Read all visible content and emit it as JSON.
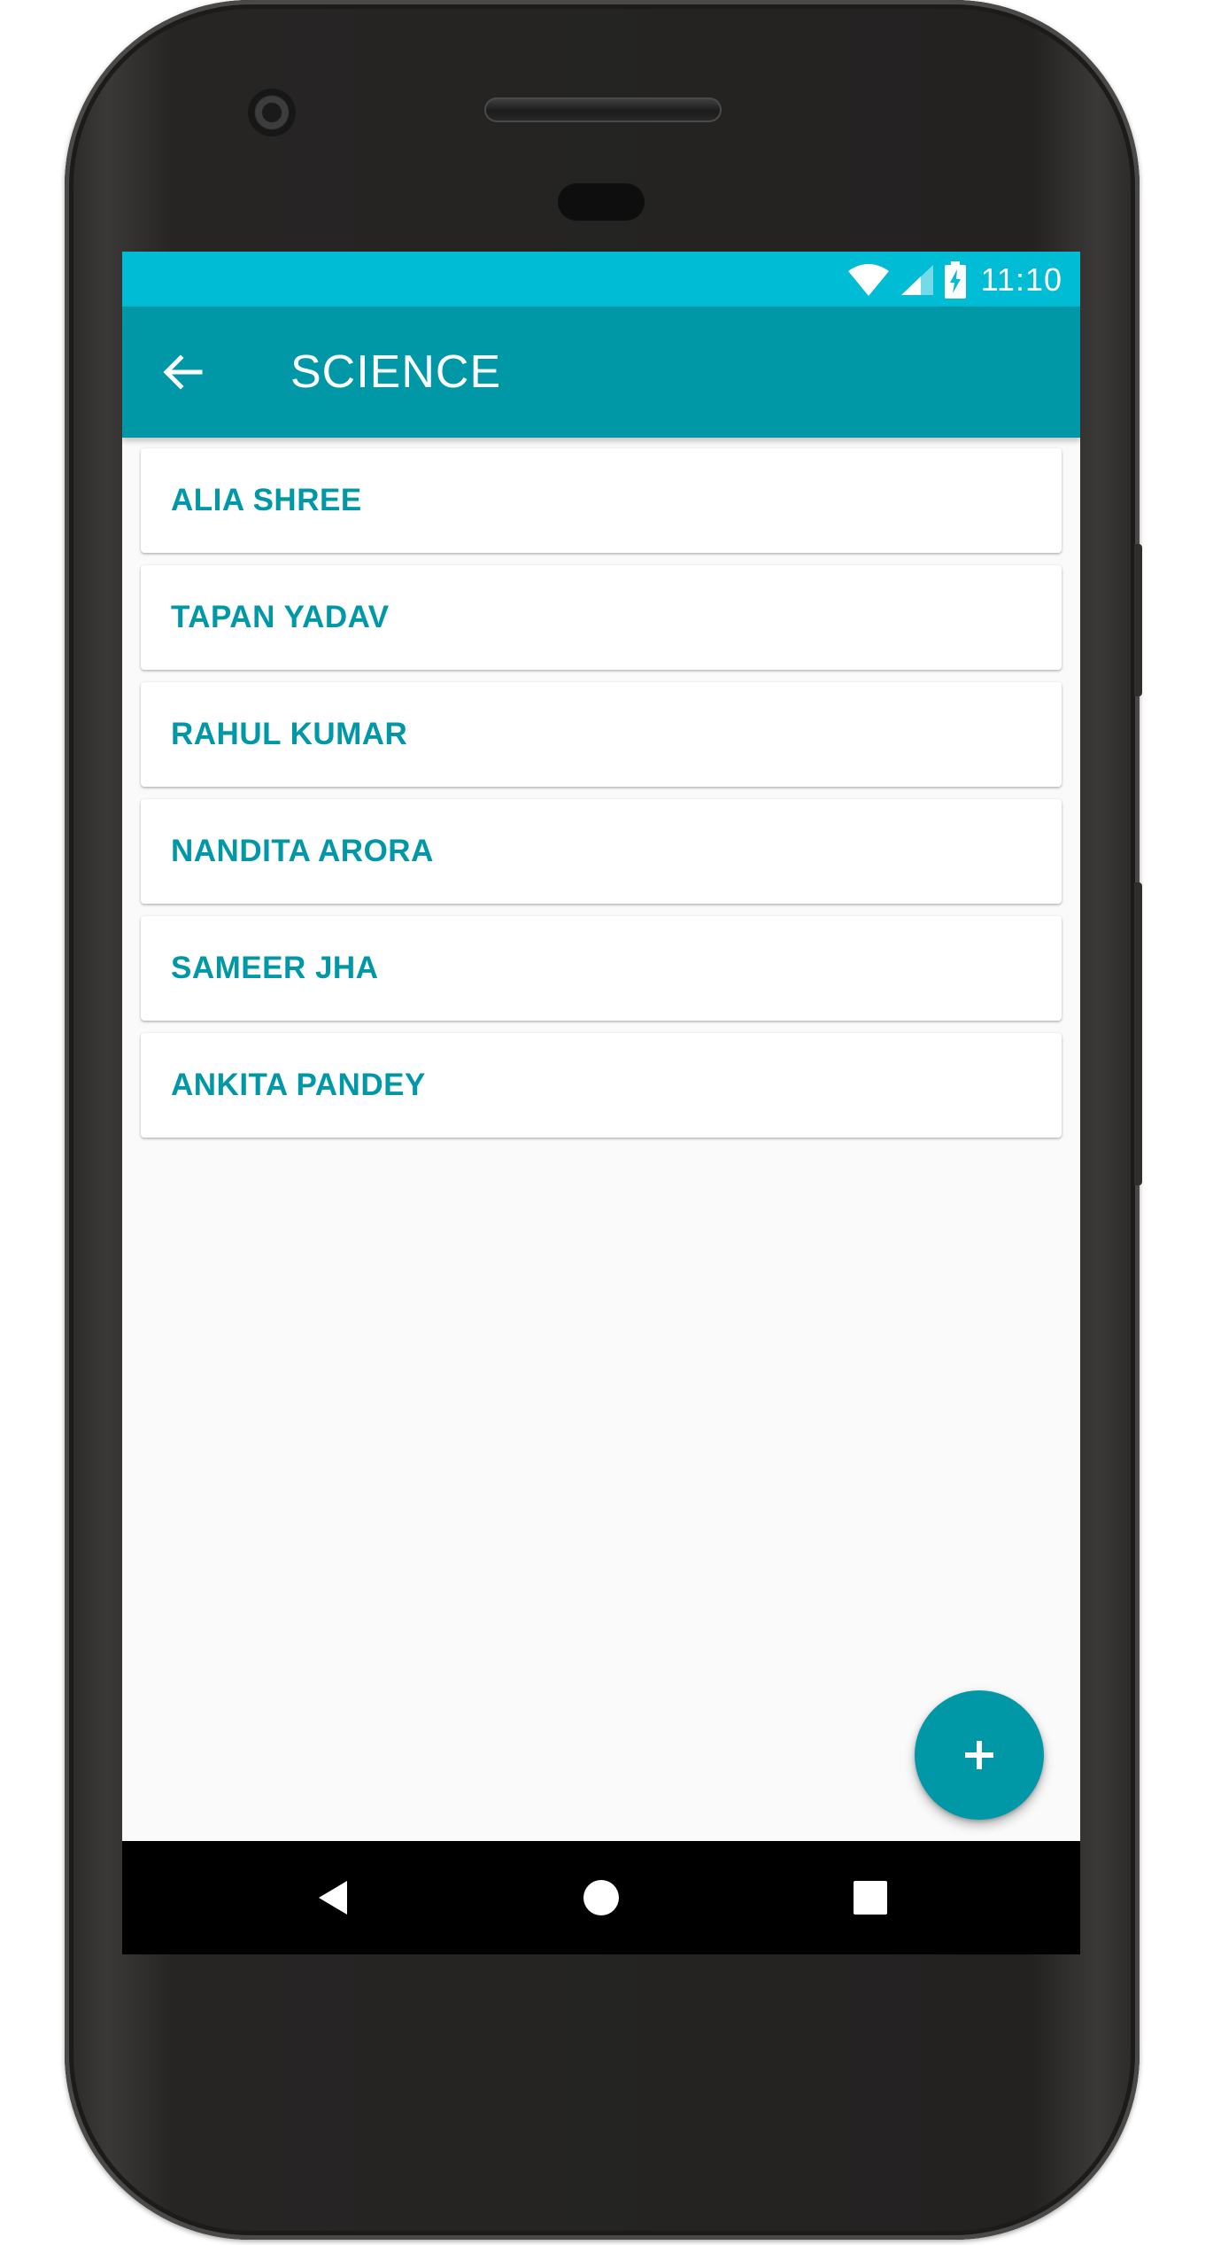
{
  "status_bar": {
    "time": "11:10",
    "icons": [
      "wifi-icon",
      "signal-icon",
      "battery-charging-icon"
    ],
    "color": "#00bcd4"
  },
  "app_bar": {
    "title": "SCIENCE",
    "back_icon": "arrow-back-icon",
    "color": "#0097a7"
  },
  "students": [
    {
      "name": "ALIA SHREE"
    },
    {
      "name": "TAPAN YADAV"
    },
    {
      "name": "RAHUL KUMAR"
    },
    {
      "name": "NANDITA ARORA"
    },
    {
      "name": "SAMEER JHA"
    },
    {
      "name": "ANKITA PANDEY"
    }
  ],
  "fab": {
    "icon": "plus-icon",
    "color": "#0097a7"
  },
  "navigation_bar": {
    "buttons": [
      "nav-back-icon",
      "nav-home-icon",
      "nav-recents-icon"
    ]
  },
  "accent_text_color": "#0097a7",
  "background_color": "#fafafa"
}
